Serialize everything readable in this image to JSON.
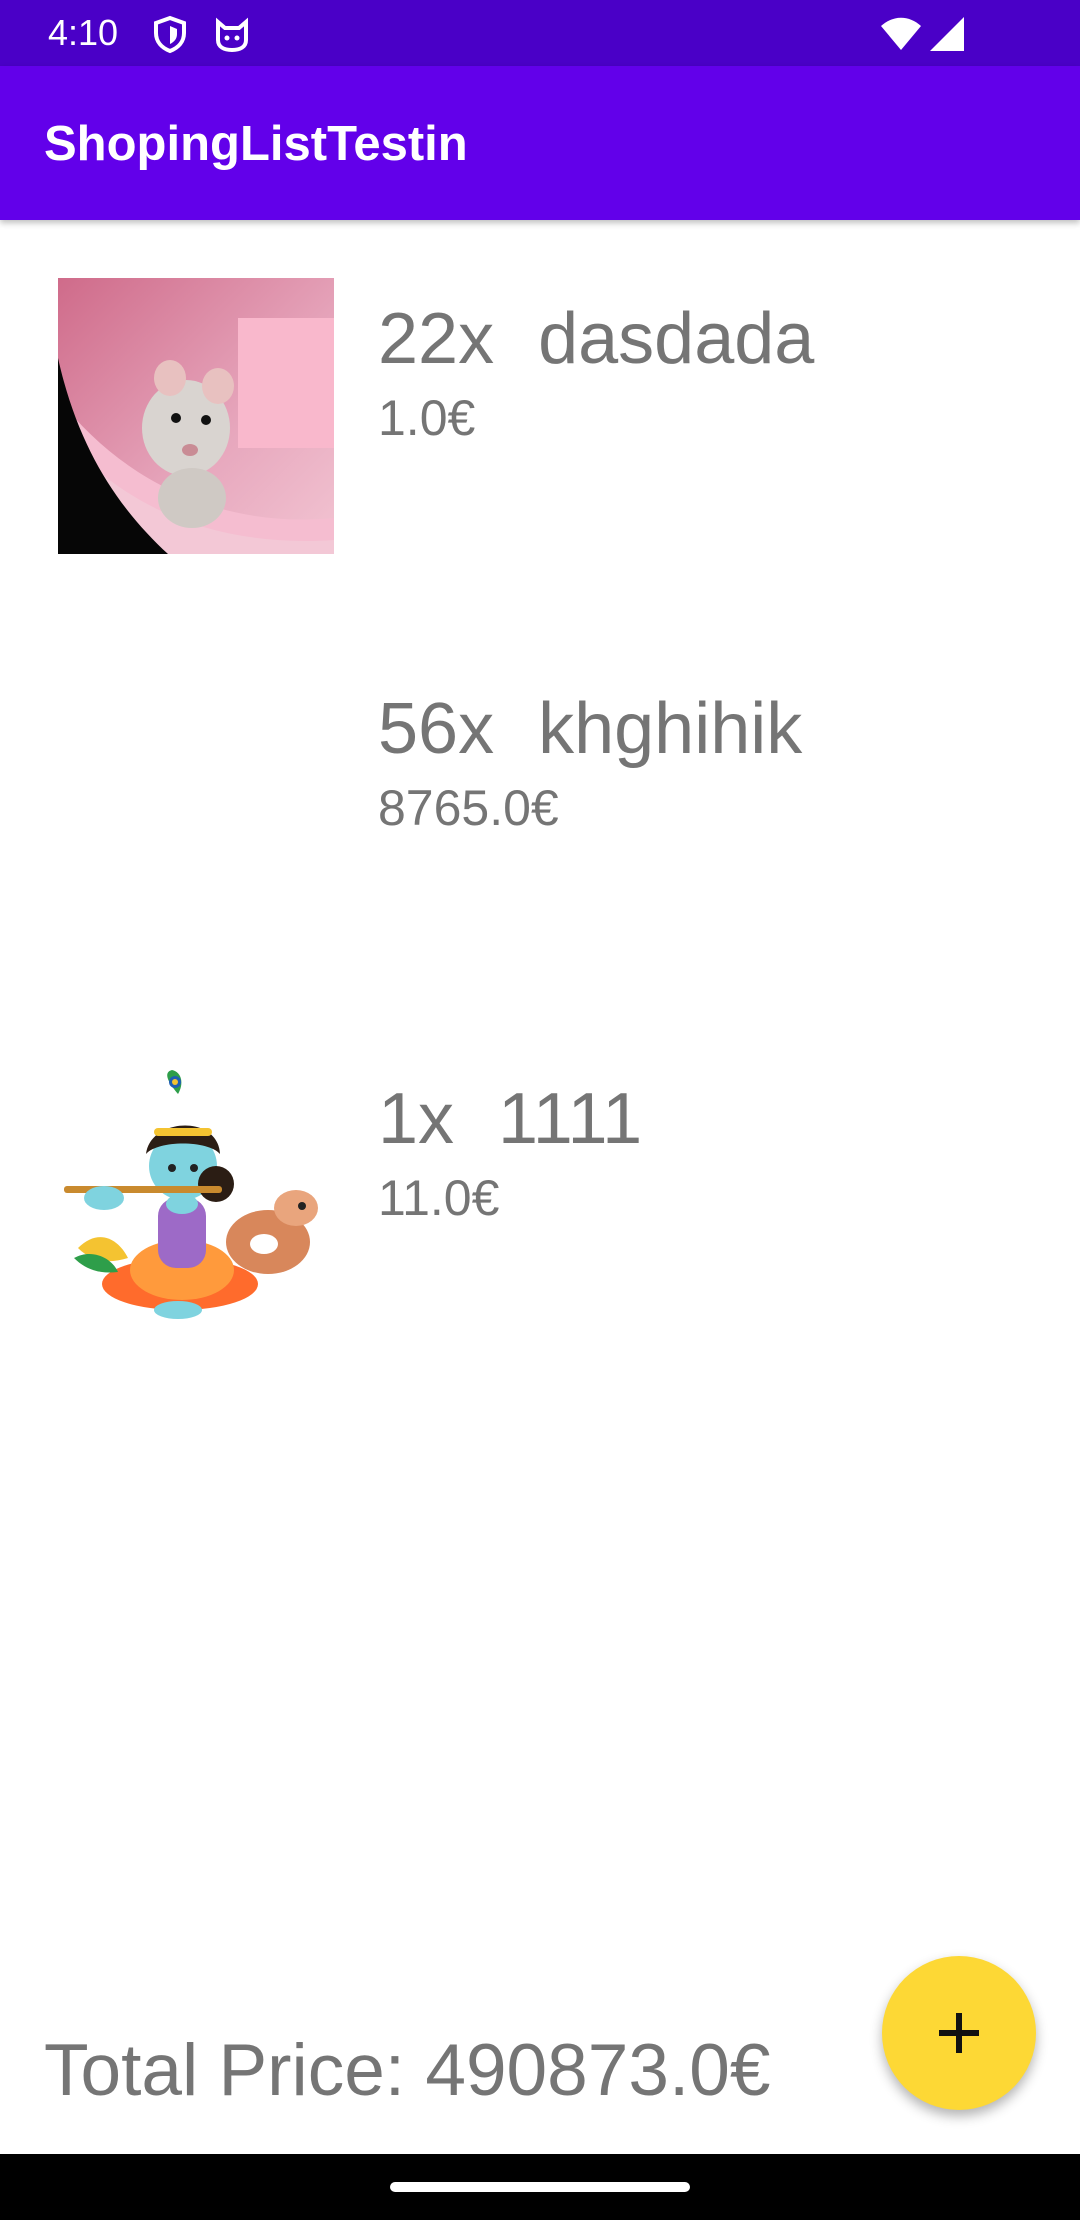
{
  "status_bar": {
    "time": "4:10",
    "icons": [
      "shield-icon",
      "cat-face-icon",
      "wifi-icon",
      "signal-icon"
    ]
  },
  "app_bar": {
    "title": "ShopingListTestin",
    "color": "#6200ea"
  },
  "items": [
    {
      "quantity": "22x",
      "name": "dasdada",
      "price": "1.0€",
      "image": "rat-photo"
    },
    {
      "quantity": "56x",
      "name": "khghihik",
      "price": "8765.0€",
      "image": "none"
    },
    {
      "quantity": "1x",
      "name": "1111",
      "price": "11.0€",
      "image": "krishna-with-calf-illustration"
    }
  ],
  "total": {
    "text": "Total Price: 490873.0€"
  },
  "fab": {
    "icon": "plus-icon",
    "color": "#fdd835"
  }
}
